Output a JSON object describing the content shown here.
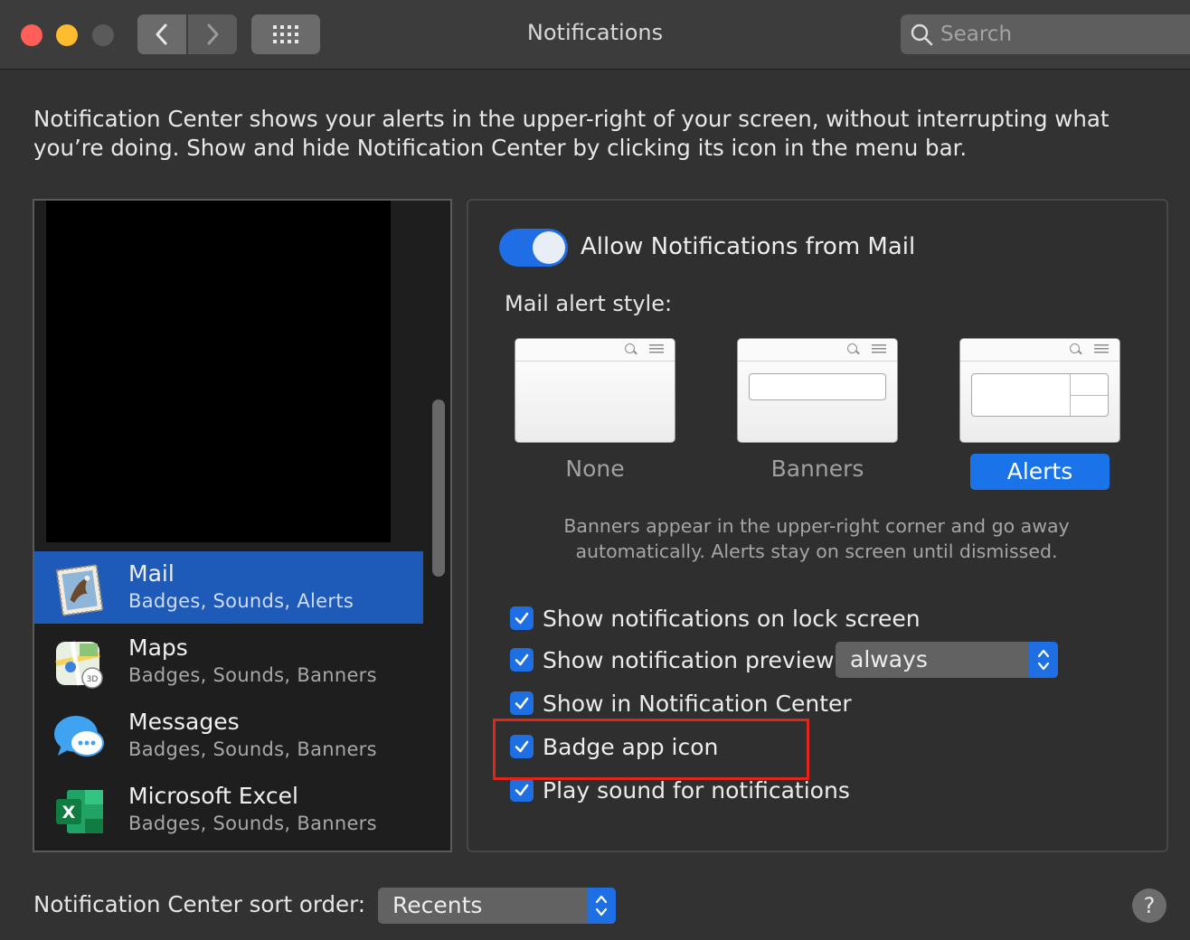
{
  "window": {
    "title": "Notifications"
  },
  "search": {
    "placeholder": "Search"
  },
  "intro": "Notification Center shows your alerts in the upper-right of your screen, without interrupting what you’re doing. Show and hide Notification Center by clicking its icon in the menu bar.",
  "apps": [
    {
      "name": "Mail",
      "subtitle": "Badges, Sounds, Alerts",
      "icon": "mail-app-icon",
      "selected": true
    },
    {
      "name": "Maps",
      "subtitle": "Badges, Sounds, Banners",
      "icon": "maps-app-icon",
      "selected": false
    },
    {
      "name": "Messages",
      "subtitle": "Badges, Sounds, Banners",
      "icon": "messages-app-icon",
      "selected": false
    },
    {
      "name": "Microsoft Excel",
      "subtitle": "Badges, Sounds, Banners",
      "icon": "excel-app-icon",
      "selected": false
    }
  ],
  "detail": {
    "allow_label": "Allow Notifications from Mail",
    "allow_enabled": true,
    "alert_style_label": "Mail alert style:",
    "styles": [
      {
        "name": "None",
        "selected": false
      },
      {
        "name": "Banners",
        "selected": false
      },
      {
        "name": "Alerts",
        "selected": true
      }
    ],
    "help_text": "Banners appear in the upper-right corner and go away automatically. Alerts stay on screen until dismissed.",
    "options": [
      {
        "label": "Show notifications on lock screen",
        "checked": true
      },
      {
        "label": "Show notification preview",
        "checked": true
      },
      {
        "label": "Show in Notification Center",
        "checked": true
      },
      {
        "label": "Badge app icon",
        "checked": true
      },
      {
        "label": "Play sound for notifications",
        "checked": true
      }
    ],
    "preview_value": "always"
  },
  "footer": {
    "sort_label": "Notification Center sort order:",
    "sort_value": "Recents",
    "help": "?"
  },
  "colors": {
    "accent": "#1e6fe4",
    "highlight": "#e3241b",
    "selection": "#1e5ab8"
  }
}
